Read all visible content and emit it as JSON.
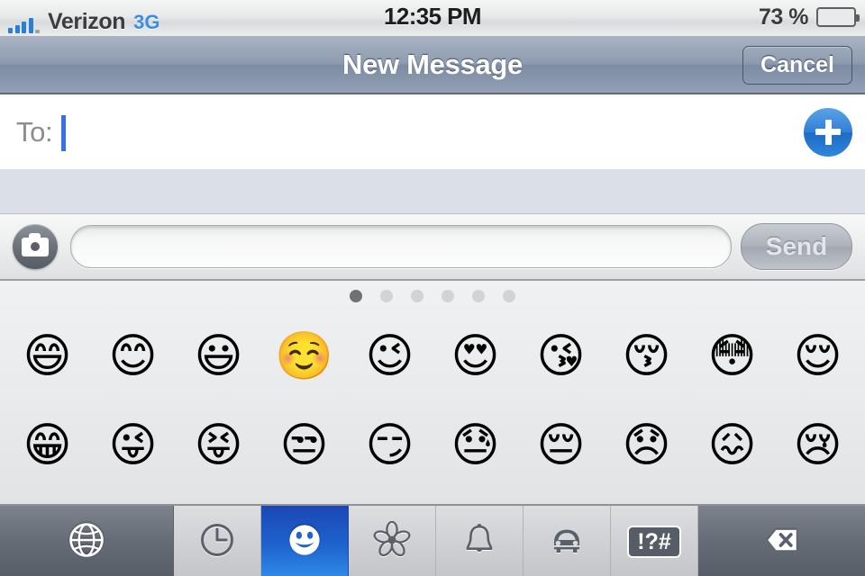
{
  "status_bar": {
    "carrier": "Verizon",
    "network": "3G",
    "signal_icon": "signal-bars-icon",
    "signal_bars_filled": 4,
    "signal_bars_total": 5,
    "time": "12:35 PM",
    "battery_percent": "73 %",
    "battery_level": 73,
    "battery_icon": "battery-icon",
    "battery_color": "#69c01c"
  },
  "nav_bar": {
    "title": "New Message",
    "cancel_label": "Cancel"
  },
  "to_field": {
    "label": "To:",
    "value": "",
    "caret_color": "#3a6ee8",
    "add_contact_icon": "plus-circle-icon"
  },
  "compose_bar": {
    "camera_icon": "camera-icon",
    "message_value": "",
    "message_placeholder": "",
    "send_label": "Send",
    "send_enabled": false
  },
  "emoji_keyboard": {
    "page_count": 6,
    "active_page": 1,
    "rows": [
      [
        {
          "glyph": "😄",
          "name": "smiling-face-open-mouth-smiling-eyes"
        },
        {
          "glyph": "😊",
          "name": "smiling-face-smiling-eyes"
        },
        {
          "glyph": "😃",
          "name": "smiling-face-open-mouth"
        },
        {
          "glyph": "☺️",
          "name": "white-smiling-face"
        },
        {
          "glyph": "😉",
          "name": "winking-face"
        },
        {
          "glyph": "😍",
          "name": "smiling-face-heart-eyes"
        },
        {
          "glyph": "😘",
          "name": "face-throwing-a-kiss"
        },
        {
          "glyph": "😚",
          "name": "kissing-face-closed-eyes"
        },
        {
          "glyph": "😳",
          "name": "flushed-face"
        },
        {
          "glyph": "😌",
          "name": "relieved-face"
        }
      ],
      [
        {
          "glyph": "😁",
          "name": "grinning-face-smiling-eyes"
        },
        {
          "glyph": "😜",
          "name": "face-stuck-out-tongue-winking-eye"
        },
        {
          "glyph": "😝",
          "name": "face-stuck-out-tongue-closed-eyes"
        },
        {
          "glyph": "😒",
          "name": "unamused-face"
        },
        {
          "glyph": "😏",
          "name": "smirking-face"
        },
        {
          "glyph": "😓",
          "name": "face-with-cold-sweat"
        },
        {
          "glyph": "😔",
          "name": "pensive-face"
        },
        {
          "glyph": "😞",
          "name": "disappointed-face"
        },
        {
          "glyph": "😖",
          "name": "confounded-face"
        },
        {
          "glyph": "😢",
          "name": "crying-face"
        }
      ]
    ]
  },
  "keyboard_toolbar": {
    "keys": [
      {
        "name": "globe-key",
        "icon": "globe-icon",
        "label": "",
        "state": "dark"
      },
      {
        "name": "recent-key",
        "icon": "clock-icon",
        "label": "",
        "state": "normal"
      },
      {
        "name": "emoji-people-key",
        "icon": "smiley-icon",
        "label": "",
        "state": "active"
      },
      {
        "name": "emoji-nature-key",
        "icon": "flower-icon",
        "label": "",
        "state": "normal"
      },
      {
        "name": "emoji-objects-key",
        "icon": "bell-icon",
        "label": "",
        "state": "normal"
      },
      {
        "name": "emoji-places-key",
        "icon": "car-icon",
        "label": "",
        "state": "normal"
      },
      {
        "name": "emoji-symbols-key",
        "icon": "symbols-icon",
        "label": "!?#",
        "state": "normal"
      },
      {
        "name": "delete-key",
        "icon": "backspace-icon",
        "label": "",
        "state": "dark"
      }
    ]
  }
}
